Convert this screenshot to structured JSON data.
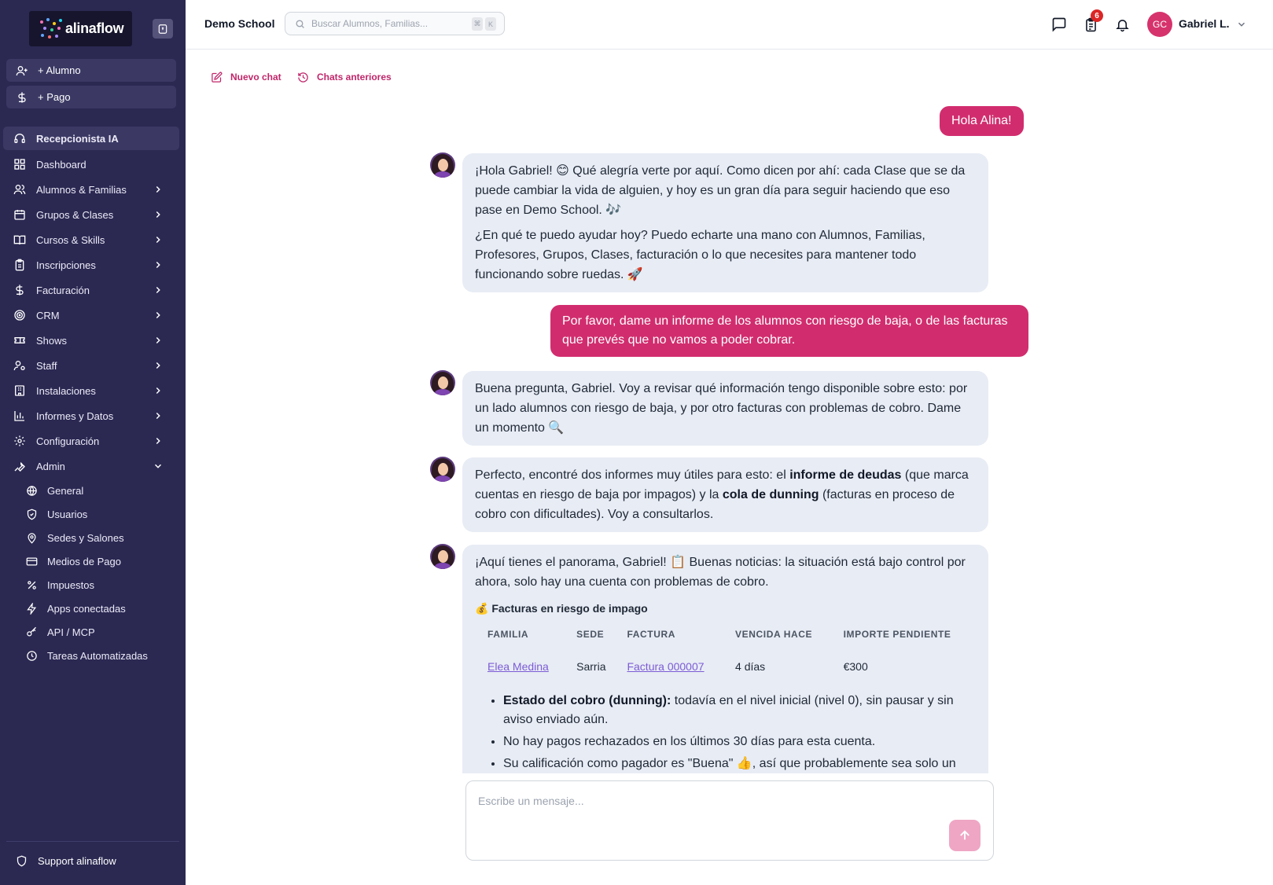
{
  "brand": {
    "name": "alinaflow",
    "accent": "#d12d6e",
    "sidebar_bg": "#2b2952"
  },
  "sidebar": {
    "quick_actions": [
      {
        "label": "+ Alumno",
        "icon": "user-plus-icon"
      },
      {
        "label": "+ Pago",
        "icon": "dollar-icon"
      }
    ],
    "items": [
      {
        "label": "Recepcionista IA",
        "icon": "headset-icon",
        "active": true
      },
      {
        "label": "Dashboard",
        "icon": "grid-icon"
      },
      {
        "label": "Alumnos & Familias",
        "icon": "users-icon"
      },
      {
        "label": "Grupos & Clases",
        "icon": "calendar-icon"
      },
      {
        "label": "Cursos & Skills",
        "icon": "book-icon"
      },
      {
        "label": "Inscripciones",
        "icon": "clipboard-icon"
      },
      {
        "label": "Facturación",
        "icon": "dollar-icon"
      },
      {
        "label": "CRM",
        "icon": "target-icon"
      },
      {
        "label": "Shows",
        "icon": "ticket-icon"
      },
      {
        "label": "Staff",
        "icon": "user-gear-icon"
      },
      {
        "label": "Instalaciones",
        "icon": "building-icon"
      },
      {
        "label": "Informes y Datos",
        "icon": "bar-chart-icon"
      },
      {
        "label": "Configuración",
        "icon": "gear-icon"
      },
      {
        "label": "Admin",
        "icon": "wrench-icon",
        "expanded": true
      }
    ],
    "admin_items": [
      {
        "label": "General",
        "icon": "globe-icon"
      },
      {
        "label": "Usuarios",
        "icon": "shield-check-icon"
      },
      {
        "label": "Sedes y Salones",
        "icon": "map-pin-icon"
      },
      {
        "label": "Medios de Pago",
        "icon": "credit-card-icon"
      },
      {
        "label": "Impuestos",
        "icon": "percent-icon"
      },
      {
        "label": "Apps conectadas",
        "icon": "bolt-icon"
      },
      {
        "label": "API / MCP",
        "icon": "key-icon"
      },
      {
        "label": "Tareas Automatizadas",
        "icon": "clock-icon"
      }
    ],
    "support_label": "Support alinaflow"
  },
  "header": {
    "school": "Demo School",
    "search_placeholder": "Buscar Alumnos, Familias...",
    "kbd_1": "⌘",
    "kbd_2": "K",
    "badge_count": "6",
    "avatar_initials": "GC",
    "user_name": "Gabriel L."
  },
  "chat": {
    "new_chat": "Nuevo chat",
    "previous_chats": "Chats anteriores",
    "messages": {
      "m1_user": "Hola Alina!",
      "m2_ai_p1": "¡Hola Gabriel! 😊 Qué alegría verte por aquí. Como dicen por ahí: cada Clase que se da puede cambiar la vida de alguien, y hoy es un gran día para seguir haciendo que eso pase en Demo School. 🎶",
      "m2_ai_p2": "¿En qué te puedo ayudar hoy? Puedo echarte una mano con Alumnos, Familias, Profesores, Grupos, Clases, facturación o lo que necesites para mantener todo funcionando sobre ruedas. 🚀",
      "m3_user": "Por favor, dame un informe de los alumnos con riesgo de baja, o de las facturas que prevés que no vamos a poder cobrar.",
      "m4_ai": "Buena pregunta, Gabriel. Voy a revisar qué información tengo disponible sobre esto: por un lado alumnos con riesgo de baja, y por otro facturas con problemas de cobro. Dame un momento 🔍",
      "m5_ai_a": "Perfecto, encontré dos informes muy útiles para esto: el ",
      "m5_ai_b": "informe de deudas",
      "m5_ai_c": " (que marca cuentas en riesgo de baja por impagos) y la ",
      "m5_ai_d": "cola de dunning",
      "m5_ai_e": " (facturas en proceso de cobro con dificultades). Voy a consultarlos.",
      "m6_ai_intro": "¡Aquí tienes el panorama, Gabriel! 📋 Buenas noticias: la situación está bajo control por ahora, solo hay una cuenta con problemas de cobro.",
      "m6_table_title": "💰 Facturas en riesgo de impago",
      "m6_table": {
        "headers": [
          "FAMILIA",
          "SEDE",
          "FACTURA",
          "VENCIDA HACE",
          "IMPORTE PENDIENTE"
        ],
        "row": {
          "familia": "Elea Medina",
          "sede": "Sarria",
          "factura": "Factura 000007",
          "vencida": "4 días",
          "importe": "€300"
        }
      },
      "m6_b1_label": "Estado del cobro (dunning):",
      "m6_b1_text": " todavía en el nivel inicial (nivel 0), sin pausar y sin aviso enviado aún.",
      "m6_b2": "No hay pagos rechazados en los últimos 30 días para esta cuenta.",
      "m6_b3": "Su calificación como pagador es \"Buena\" 👍, así que probablemente sea solo un retraso puntual, no necesariamente una señal grave."
    },
    "composer_placeholder": "Escribe un mensaje..."
  }
}
